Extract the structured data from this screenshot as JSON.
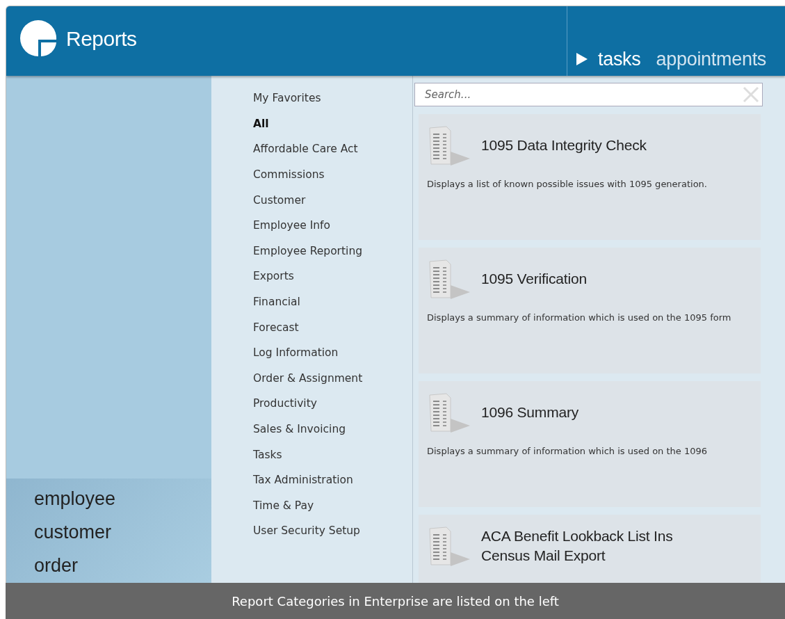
{
  "header": {
    "title": "Reports",
    "nav": [
      {
        "label": "tasks",
        "selected": true
      },
      {
        "label": "appointments",
        "selected": false
      }
    ]
  },
  "left_nav": [
    "employee",
    "customer",
    "order"
  ],
  "categories": [
    {
      "label": "My Favorites",
      "selected": false
    },
    {
      "label": "All",
      "selected": true
    },
    {
      "label": "Affordable Care Act",
      "selected": false
    },
    {
      "label": "Commissions",
      "selected": false
    },
    {
      "label": "Customer",
      "selected": false
    },
    {
      "label": "Employee Info",
      "selected": false
    },
    {
      "label": "Employee Reporting",
      "selected": false
    },
    {
      "label": "Exports",
      "selected": false
    },
    {
      "label": "Financial",
      "selected": false
    },
    {
      "label": "Forecast",
      "selected": false
    },
    {
      "label": "Log Information",
      "selected": false
    },
    {
      "label": "Order & Assignment",
      "selected": false
    },
    {
      "label": "Productivity",
      "selected": false
    },
    {
      "label": "Sales & Invoicing",
      "selected": false
    },
    {
      "label": "Tasks",
      "selected": false
    },
    {
      "label": "Tax Administration",
      "selected": false
    },
    {
      "label": "Time & Pay",
      "selected": false
    },
    {
      "label": "User Security Setup",
      "selected": false
    }
  ],
  "search": {
    "placeholder": "Search..."
  },
  "reports": [
    {
      "title": "1095 Data Integrity Check",
      "description": "Displays a list of known possible issues with 1095 generation."
    },
    {
      "title": "1095 Verification",
      "description": "Displays a summary of information which is used on the 1095 form"
    },
    {
      "title": "1096 Summary",
      "description": "Displays a summary of information which is used on the 1096"
    },
    {
      "title": "ACA Benefit Lookback List Ins Census Mail Export"
    }
  ],
  "caption": "Report Categories in Enterprise are listed on the left"
}
